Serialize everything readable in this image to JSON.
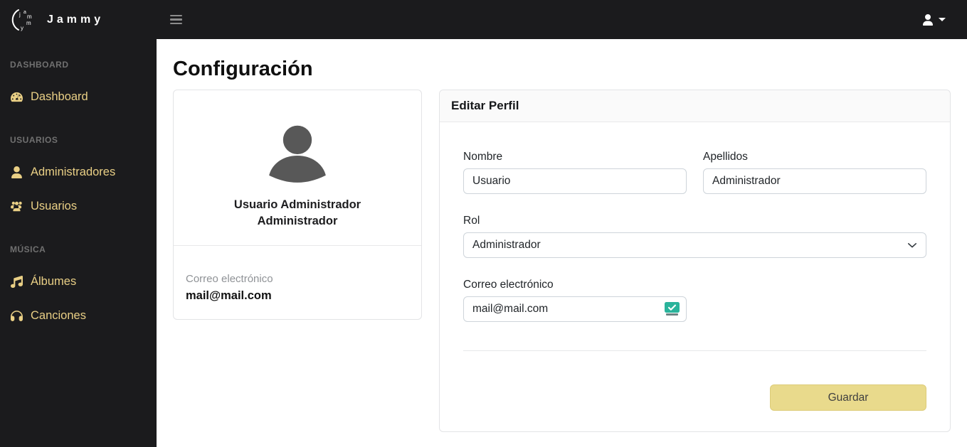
{
  "brand": {
    "name": "Jammy",
    "logo_letters": [
      "j",
      "a",
      "m",
      "m",
      "y"
    ]
  },
  "sidebar": {
    "sections": [
      {
        "label": "DASHBOARD",
        "items": [
          {
            "label": "Dashboard",
            "icon": "speedometer-icon"
          }
        ]
      },
      {
        "label": "USUARIOS",
        "items": [
          {
            "label": "Administradores",
            "icon": "person-icon"
          },
          {
            "label": "Usuarios",
            "icon": "people-icon"
          }
        ]
      },
      {
        "label": "MÚSICA",
        "items": [
          {
            "label": "Álbumes",
            "icon": "music-note-icon"
          },
          {
            "label": "Canciones",
            "icon": "headphones-icon"
          }
        ]
      }
    ]
  },
  "page": {
    "title": "Configuración"
  },
  "profile_card": {
    "name": "Usuario Administrador",
    "role": "Administrador",
    "email_label": "Correo electrónico",
    "email": "mail@mail.com"
  },
  "edit_card": {
    "title": "Editar Perfil",
    "fields": {
      "nombre": {
        "label": "Nombre",
        "value": "Usuario"
      },
      "apellidos": {
        "label": "Apellidos",
        "value": "Administrador"
      },
      "rol": {
        "label": "Rol",
        "value": "Administrador"
      },
      "correo": {
        "label": "Correo electrónico",
        "value": "mail@mail.com"
      }
    },
    "save_label": "Guardar"
  },
  "colors": {
    "sidebar_bg": "#1b1b1d",
    "accent_gold": "#e9cf85",
    "button_bg": "#e9da8c",
    "button_text": "#404040",
    "mail_icon_teal": "#2ab39b",
    "avatar_gray": "#585858",
    "section_label_gray": "#707070"
  }
}
